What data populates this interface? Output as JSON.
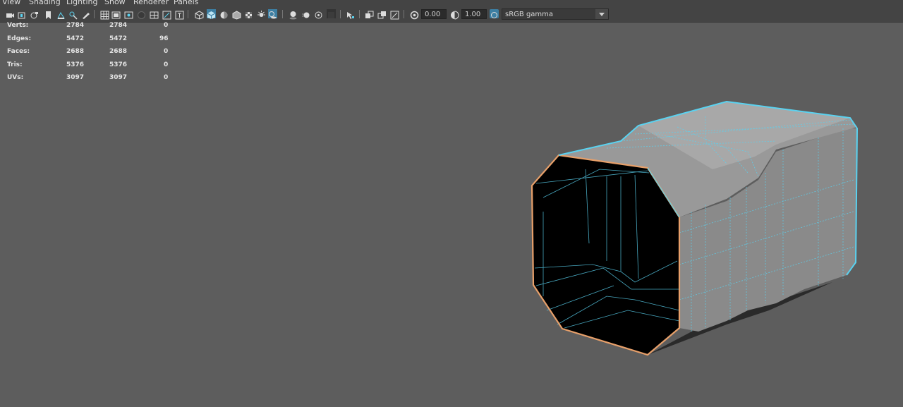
{
  "menu": [
    "View",
    "Shading",
    "Lighting",
    "Show",
    "Renderer",
    "Panels"
  ],
  "toolbar": {
    "icons": [
      "camera-icon",
      "camera-attributes-icon",
      "camera-tools-icon",
      "bookmark-icon",
      "image-plane-icon",
      "2d-pan-zoom-icon",
      "grease-pencil-icon",
      "grid-icon",
      "film-gate-icon",
      "resolution-gate-icon",
      "gate-mask-icon",
      "field-chart-icon",
      "safe-action-icon",
      "safe-title-icon",
      "wireframe-icon",
      "smooth-shade-icon",
      "use-default-material-icon",
      "wireframe-on-shaded-icon",
      "textured-icon",
      "use-all-lights-icon",
      "shadows-icon",
      "screen-space-ao-icon",
      "motion-blur-icon",
      "anti-aliasing-icon",
      "depth-of-field-icon",
      "isolate-select-icon",
      "xray-icon",
      "xray-active-components-icon",
      "xray-joints-icon",
      "backface-culling-icon",
      "exposure-icon",
      "gamma-icon",
      "color-management-icon"
    ],
    "exposure": "0.00",
    "gamma": "1.00",
    "color_space": "sRGB gamma"
  },
  "hud": {
    "rows": [
      {
        "label": "Verts:",
        "object": "2784",
        "selected": "2784",
        "components": "0"
      },
      {
        "label": "Edges:",
        "object": "5472",
        "selected": "5472",
        "components": "96"
      },
      {
        "label": "Faces:",
        "object": "2688",
        "selected": "2688",
        "components": "0"
      },
      {
        "label": "Tris:",
        "object": "5376",
        "selected": "5376",
        "components": "0"
      },
      {
        "label": "UVs:",
        "object": "3097",
        "selected": "3097",
        "components": "0"
      }
    ]
  },
  "colors": {
    "viewport_bg": "#5d5d5d",
    "wire_selected": "#5ad2f0",
    "edge_selected": "#e8a06a",
    "mesh_fill": "#8e8e8e"
  }
}
